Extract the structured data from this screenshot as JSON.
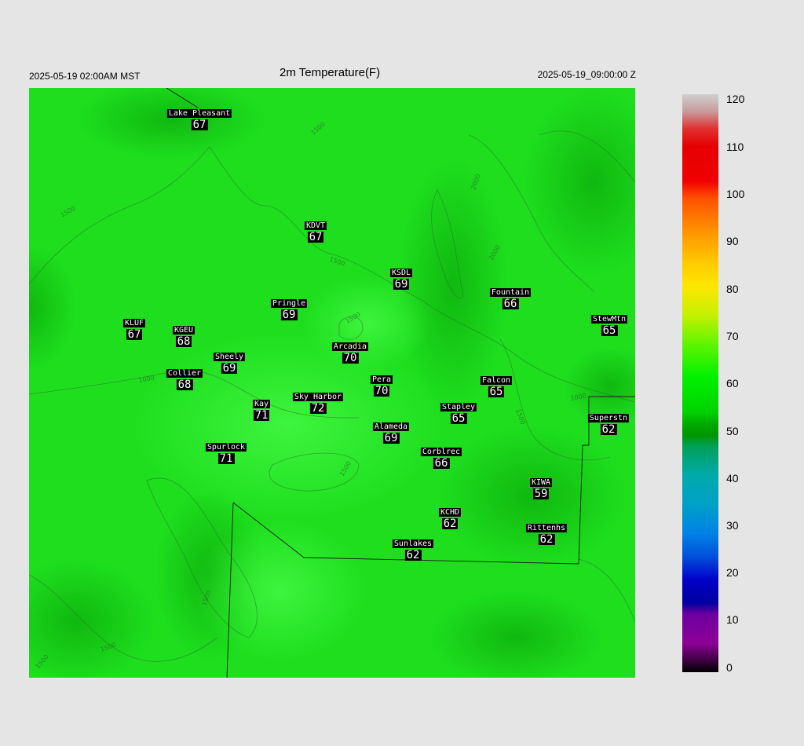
{
  "header": {
    "left": "2025-05-19 02:00AM MST",
    "title": "2m Temperature(F)",
    "right": "2025-05-19_09:00:00 Z"
  },
  "stations": [
    {
      "name": "Lake Pleasant",
      "value": "67"
    },
    {
      "name": "KDVT",
      "value": "67"
    },
    {
      "name": "KSDL",
      "value": "69"
    },
    {
      "name": "Fountain",
      "value": "66"
    },
    {
      "name": "StewMtn",
      "value": "65"
    },
    {
      "name": "Pringle",
      "value": "69"
    },
    {
      "name": "KLUF",
      "value": "67"
    },
    {
      "name": "KGEU",
      "value": "68"
    },
    {
      "name": "Arcadia",
      "value": "70"
    },
    {
      "name": "Sheely",
      "value": "69"
    },
    {
      "name": "Collier",
      "value": "68"
    },
    {
      "name": "Pera",
      "value": "70"
    },
    {
      "name": "Falcon",
      "value": "65"
    },
    {
      "name": "Kay",
      "value": "71"
    },
    {
      "name": "Sky Harbor",
      "value": "72"
    },
    {
      "name": "Stapley",
      "value": "65"
    },
    {
      "name": "Superstn",
      "value": "62"
    },
    {
      "name": "Alameda",
      "value": "69"
    },
    {
      "name": "Spurlock",
      "value": "71"
    },
    {
      "name": "Corblrec",
      "value": "66"
    },
    {
      "name": "KIWA",
      "value": "59"
    },
    {
      "name": "KCHD",
      "value": "62"
    },
    {
      "name": "Rittenhs",
      "value": "62"
    },
    {
      "name": "Sunlakes",
      "value": "62"
    }
  ],
  "contour_labels": [
    "1500",
    "2000",
    "2000",
    "1500",
    "1500",
    "1000",
    "1500",
    "1500",
    "1500",
    "1500",
    "1500",
    "1000",
    "1500"
  ],
  "colorbar": {
    "ticks": [
      "120",
      "110",
      "100",
      "90",
      "80",
      "70",
      "60",
      "50",
      "40",
      "30",
      "20",
      "10",
      "0"
    ],
    "colors": {
      "high": "#c8c8c8",
      "red": "#e60000",
      "orange": "#ff8c00",
      "yellow": "#ffe600",
      "lime": "#7fff00",
      "green": "#00e600",
      "darkgreen": "#00a000",
      "teal": "#00a0a0",
      "blue": "#0064e6",
      "navy": "#0000b4",
      "purple": "#8c0096",
      "black": "#000000"
    }
  },
  "map_colors": {
    "field": "#1fe01f",
    "warm": "#3cf03c",
    "cool": "#10c010"
  }
}
